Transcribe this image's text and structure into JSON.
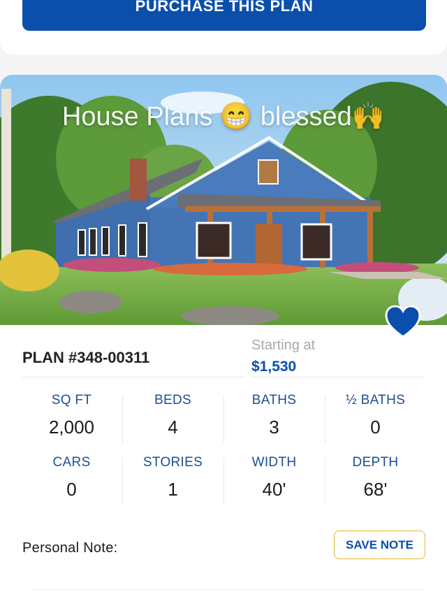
{
  "top": {
    "purchase_label": "PURCHASE THIS PLAN"
  },
  "hero": {
    "overlay_text": "House Plans 😁 blessed🙌",
    "heart_color": "#0b4fad"
  },
  "plan": {
    "number": "PLAN #348-00311",
    "starting_label": "Starting at",
    "price": "$1,530"
  },
  "stats": [
    {
      "label": "SQ FT",
      "value": "2,000"
    },
    {
      "label": "BEDS",
      "value": "4"
    },
    {
      "label": "BATHS",
      "value": "3"
    },
    {
      "label": "½ BATHS",
      "value": "0"
    },
    {
      "label": "CARS",
      "value": "0"
    },
    {
      "label": "STORIES",
      "value": "1"
    },
    {
      "label": "WIDTH",
      "value": "40'"
    },
    {
      "label": "DEPTH",
      "value": "68'"
    }
  ],
  "note": {
    "label": "Personal Note:",
    "save_label": "SAVE NOTE"
  },
  "colors": {
    "brand_blue": "#0b4fad",
    "accent_gold": "#e4b829"
  }
}
